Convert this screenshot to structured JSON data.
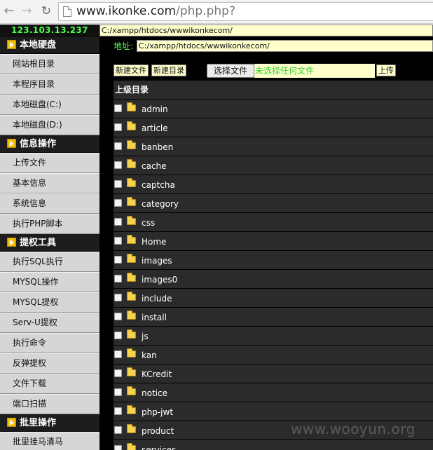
{
  "browser": {
    "url_host": "www.ikonke.com",
    "url_path": "/php.php?"
  },
  "sidebar": {
    "ip": "123.103.13.237",
    "sections": [
      {
        "title": "本地硬盘",
        "items": [
          "网站根目录",
          "本程序目录",
          "本地磁盘(C:)",
          "本地磁盘(D:)"
        ]
      },
      {
        "title": "信息操作",
        "items": [
          "上传文件",
          "基本信息",
          "系统信息",
          "执行PHP脚本"
        ]
      },
      {
        "title": "提权工具",
        "items": [
          "执行SQL执行",
          "MYSQL操作",
          "MYSQL提权",
          "Serv-U提权",
          "执行命令",
          "反弹提权",
          "文件下载",
          "端口扫描"
        ]
      },
      {
        "title": "批里操作",
        "items": [
          "批里挂马清马"
        ]
      }
    ]
  },
  "pathbar": {
    "value": "C:/xampp/htdocs/wwwikonkecom/"
  },
  "main": {
    "address_label": "地址:",
    "address_value": "C:/xampp/htdocs/wwwikonkecom/",
    "new_file_label": "新建文件",
    "new_dir_label": "新建目录",
    "choose_file_label": "选择文件",
    "no_file_text": "未选择任何文件",
    "upload_label": "上传",
    "parent_dir_label": "上级目录",
    "folders": [
      "admin",
      "article",
      "banben",
      "cache",
      "captcha",
      "category",
      "css",
      "Home",
      "images",
      "images0",
      "include",
      "install",
      "js",
      "kan",
      "KCredit",
      "notice",
      "php-jwt",
      "product",
      "services"
    ]
  },
  "watermark": "www.wooyun.org",
  "icons": {
    "back": "back-arrow-icon",
    "forward": "forward-arrow-icon",
    "reload": "reload-icon",
    "page": "page-icon",
    "section": "arrow-right-icon",
    "folder": "folder-icon",
    "checkbox": "checkbox"
  },
  "colors": {
    "ip_green": "#4fff4f",
    "input_yellow": "#ffffcc",
    "panel_dark": "#2b2b2b",
    "section_icon": "#f5c000",
    "folder": "#f7d24c"
  }
}
